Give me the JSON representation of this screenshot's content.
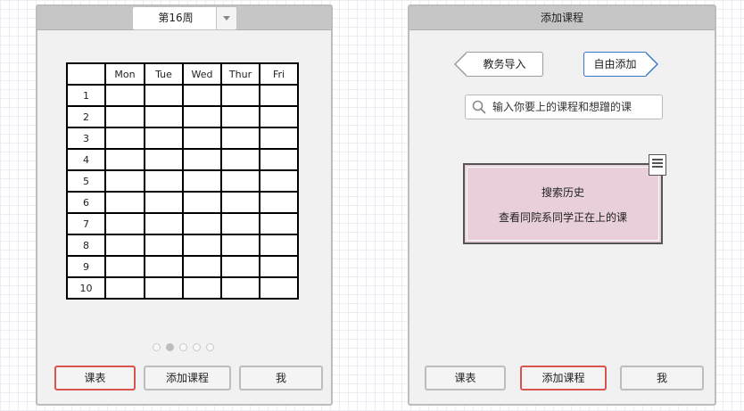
{
  "left_screen": {
    "week_selector": {
      "value": "第16周"
    },
    "timetable": {
      "days": [
        "Mon",
        "Tue",
        "Wed",
        "Thur",
        "Fri"
      ],
      "periods": [
        "1",
        "2",
        "3",
        "4",
        "5",
        "6",
        "7",
        "8",
        "9",
        "10"
      ]
    },
    "pagination": {
      "count": 5,
      "active_index": 1
    },
    "nav": {
      "items": [
        "课表",
        "添加课程",
        "我"
      ],
      "active_index": 0
    }
  },
  "right_screen": {
    "title": "添加课程",
    "source_tabs": {
      "import_label": "教务导入",
      "manual_label": "自由添加",
      "selected": "manual"
    },
    "search": {
      "placeholder": "输入你要上的课程和想蹭的课"
    },
    "note": {
      "line1": "搜索历史",
      "line2": "查看同院系同学正在上的课"
    },
    "nav": {
      "items": [
        "课表",
        "添加课程",
        "我"
      ],
      "active_index": 1
    }
  },
  "colors": {
    "active_border": "#d9534f",
    "selected_tab_border": "#3a76c8",
    "note_background": "#e8cfda",
    "header_gray": "#c6c6c6"
  },
  "icons": [
    "chevron-down-icon",
    "search-icon",
    "note-icon"
  ]
}
